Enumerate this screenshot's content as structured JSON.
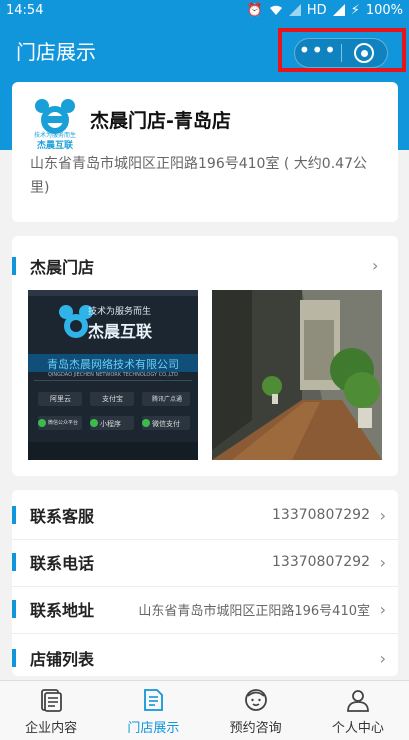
{
  "status_bar": {
    "time": "14:54",
    "network": "HD",
    "battery": "100%"
  },
  "nav": {
    "title": "门店展示"
  },
  "store": {
    "logo_text_top": "技术为服务而生",
    "logo_text": "杰晨互联",
    "name": "杰晨门店-青岛店",
    "address": "山东省青岛市城阳区正阳路196号410室 ( 大约0.47公里)"
  },
  "gallery": {
    "title": "杰晨门店",
    "photo1": {
      "slogan": "技术为服务而生",
      "brand": "杰晨互联",
      "company": "青岛杰晨网络技术有限公司",
      "company_en": "QINGDAO JIECHEN NETWORK TECHNOLOGY CO.,LTD",
      "partners": [
        "阿里云",
        "支付宝",
        "腾讯广点通",
        "微信公众平台",
        "小程序",
        "微信支付"
      ]
    }
  },
  "info_rows": [
    {
      "label": "联系客服",
      "value": "13370807292"
    },
    {
      "label": "联系电话",
      "value": "13370807292"
    },
    {
      "label": "联系地址",
      "value": "山东省青岛市城阳区正阳路196号410室"
    },
    {
      "label": "店铺列表",
      "value": ""
    }
  ],
  "tabs": [
    {
      "label": "企业内容",
      "icon": "document-icon"
    },
    {
      "label": "门店展示",
      "icon": "store-doc-icon"
    },
    {
      "label": "预约咨询",
      "icon": "face-icon"
    },
    {
      "label": "个人中心",
      "icon": "person-icon"
    }
  ],
  "colors": {
    "primary": "#1296db",
    "highlight_frame": "#e8141c"
  }
}
